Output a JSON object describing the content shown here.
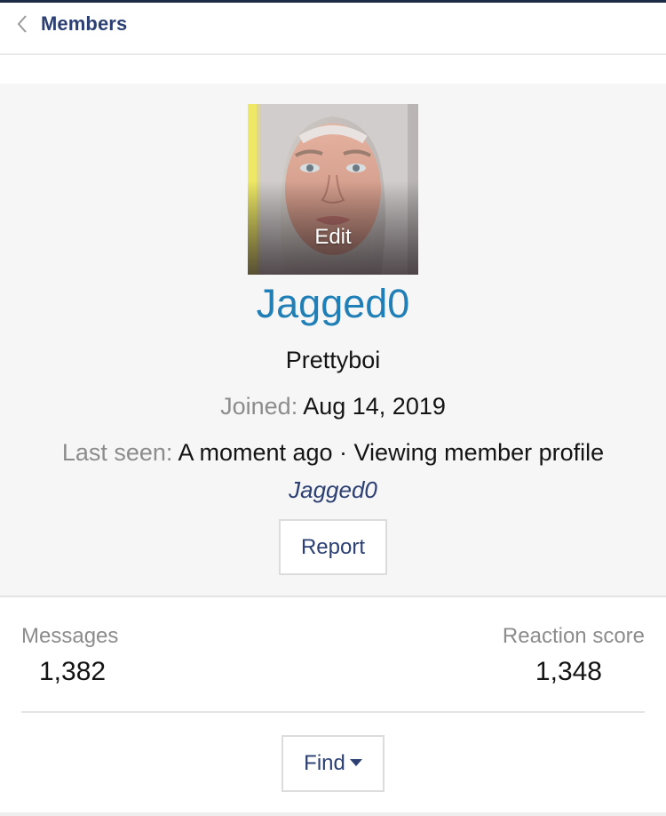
{
  "breadcrumb": {
    "label": "Members",
    "back_icon": "chevron-left-icon"
  },
  "profile": {
    "avatar_edit_label": "Edit",
    "username": "Jagged0",
    "user_title": "Prettyboi",
    "joined_label": "Joined:",
    "joined_value": "Aug 14, 2019",
    "last_seen_label": "Last seen:",
    "last_seen_value": "A moment ago · Viewing member profile",
    "activity_link": "Jagged0",
    "report_label": "Report"
  },
  "stats": {
    "messages_label": "Messages",
    "messages_value": "1,382",
    "reaction_label": "Reaction score",
    "reaction_value": "1,348"
  },
  "actions": {
    "find_label": "Find",
    "find_icon": "caret-down-icon"
  },
  "colors": {
    "accent_link": "#2b3f73",
    "username": "#1f7fb6",
    "panel_bg": "#f6f6f6",
    "muted_label": "#8c8c8c"
  }
}
